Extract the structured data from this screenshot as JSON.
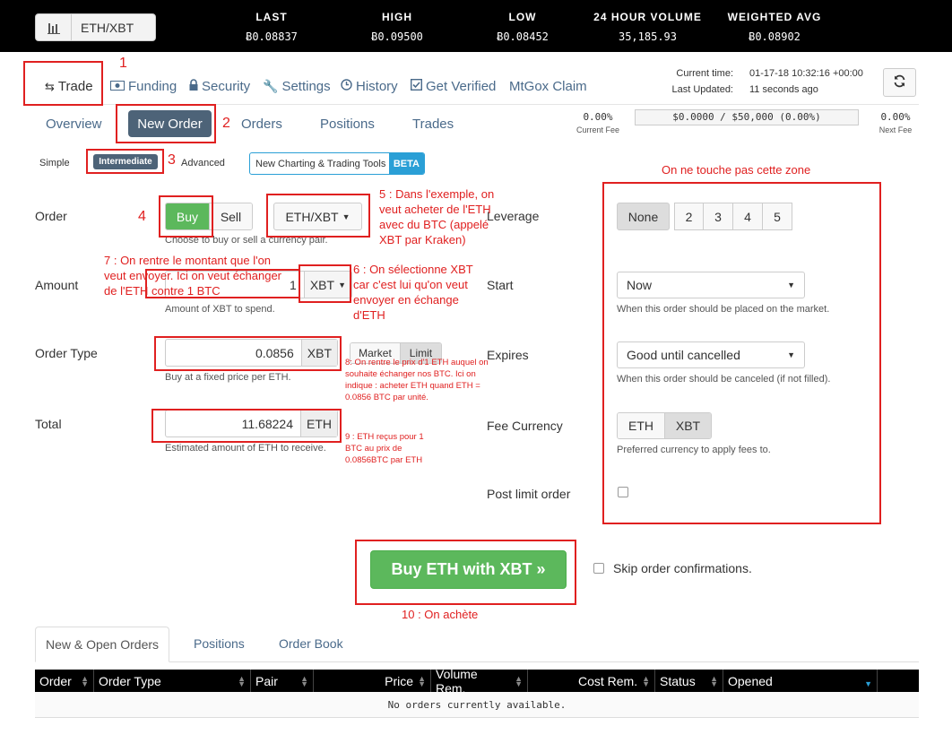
{
  "topbar": {
    "pair": "ETH/XBT",
    "stats": [
      {
        "label": "LAST",
        "value": "Ƀ0.08837"
      },
      {
        "label": "HIGH",
        "value": "Ƀ0.09500"
      },
      {
        "label": "LOW",
        "value": "Ƀ0.08452"
      },
      {
        "label": "24 HOUR VOLUME",
        "value": "35,185.93"
      },
      {
        "label": "WEIGHTED AVG",
        "value": "Ƀ0.08902"
      }
    ]
  },
  "nav": {
    "items": [
      "Trade",
      "Funding",
      "Security",
      "Settings",
      "History",
      "Get Verified",
      "MtGox Claim"
    ]
  },
  "time": {
    "current_label": "Current time:",
    "current_value": "01-17-18 10:32:16 +00:00",
    "updated_label": "Last Updated:",
    "updated_value": "11 seconds ago"
  },
  "subnav": {
    "items": [
      "Overview",
      "New Order",
      "Orders",
      "Positions",
      "Trades"
    ]
  },
  "fees": {
    "current_fee": "0.00%",
    "current_fee_label": "Current Fee",
    "progress": "$0.0000 / $50,000 (0.00%)",
    "progress_fraction": 0.0,
    "next_fee": "0.00%",
    "next_fee_label": "Next Fee"
  },
  "modes": {
    "simple": "Simple",
    "intermediate": "Intermediate",
    "advanced": "Advanced",
    "charting": "New Charting & Trading Tools",
    "beta": "BETA"
  },
  "form": {
    "order_label": "Order",
    "buy": "Buy",
    "sell": "Sell",
    "pair_dropdown": "ETH/XBT",
    "order_help": "Choose to buy or sell a currency pair.",
    "amount_label": "Amount",
    "amount_value": "1",
    "amount_currency": "XBT",
    "amount_help": "Amount of XBT to spend.",
    "order_type_label": "Order Type",
    "price_value": "0.0856",
    "price_currency": "XBT",
    "market": "Market",
    "limit": "Limit",
    "order_type_help": "Buy at a fixed price per ETH.",
    "total_label": "Total",
    "total_value": "11.68224",
    "total_currency": "ETH",
    "total_help": "Estimated amount of ETH to receive."
  },
  "right": {
    "leverage_label": "Leverage",
    "leverage_options": [
      "None",
      "2",
      "3",
      "4",
      "5"
    ],
    "start_label": "Start",
    "start_value": "Now",
    "start_help": "When this order should be placed on the market.",
    "expires_label": "Expires",
    "expires_value": "Good until cancelled",
    "expires_help": "When this order should be canceled (if not filled).",
    "fee_currency_label": "Fee Currency",
    "fee_options": [
      "ETH",
      "XBT"
    ],
    "fee_help": "Preferred currency to apply fees to.",
    "post_limit_label": "Post limit order"
  },
  "submit": {
    "button": "Buy ETH with XBT »",
    "skip": "Skip order confirmations."
  },
  "bottom_tabs": [
    "New & Open Orders",
    "Positions",
    "Order Book"
  ],
  "table": {
    "headers": [
      "Order",
      "Order Type",
      "Pair",
      "Price",
      "Volume Rem.",
      "Cost Rem.",
      "Status",
      "Opened"
    ],
    "empty": "No orders currently available."
  },
  "annotations": {
    "n1": "1",
    "n2": "2",
    "n3": "3",
    "n4": "4",
    "n5": "5 : Dans l'exemple, on veut acheter de l'ETH avec du BTC (appelé XBT par Kraken)",
    "n6": "6 : On sélectionne XBT car c'est lui qu'on veut envoyer en échange d'ETH",
    "n7": "7 : On rentre le montant que l'on veut envoyer. Ici on veut échanger de l'ETH contre 1 BTC",
    "n8": "8: On rentre le prix d'1 ETH auquel on souhaite échanger nos BTC. Ici on indique : acheter ETH quand ETH = 0.0856 BTC par unité.",
    "n9": "9 : ETH reçus pour 1 BTC au prix de 0.0856BTC par ETH",
    "n10": "10 : On achète",
    "zone": "On ne touche pas cette zone"
  }
}
